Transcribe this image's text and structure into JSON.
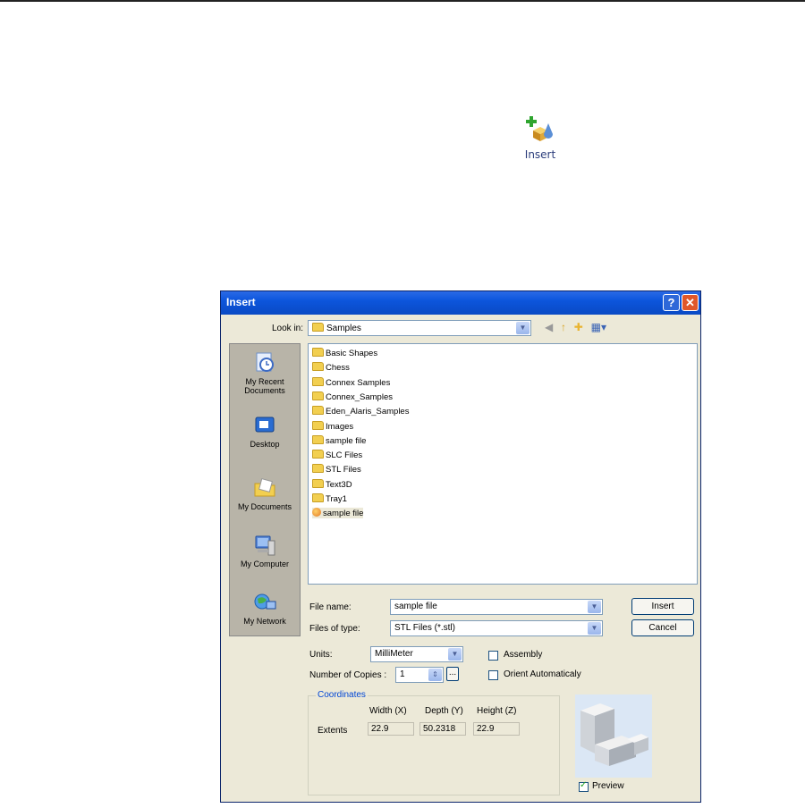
{
  "toolbar": {
    "insert_label": "Insert"
  },
  "dialog": {
    "title": "Insert",
    "help_glyph": "?",
    "close_glyph": "✕",
    "look_in_label": "Look in:",
    "look_in_value": "Samples",
    "places": [
      "My Recent Documents",
      "Desktop",
      "My Documents",
      "My Computer",
      "My Network"
    ],
    "files": [
      {
        "name": "Basic Shapes",
        "type": "folder"
      },
      {
        "name": "Chess",
        "type": "folder"
      },
      {
        "name": "Connex Samples",
        "type": "folder"
      },
      {
        "name": "Connex_Samples",
        "type": "folder"
      },
      {
        "name": "Eden_Alaris_Samples",
        "type": "folder"
      },
      {
        "name": "Images",
        "type": "folder"
      },
      {
        "name": "sample file",
        "type": "folder"
      },
      {
        "name": "SLC Files",
        "type": "folder"
      },
      {
        "name": "STL Files",
        "type": "folder"
      },
      {
        "name": "Text3D",
        "type": "folder"
      },
      {
        "name": "Tray1",
        "type": "folder"
      },
      {
        "name": "sample file",
        "type": "stl-file"
      }
    ],
    "file_name_label": "File name:",
    "file_name_value": "sample file",
    "files_of_type_label": "Files of type:",
    "files_of_type_value": "STL Files (*.stl)",
    "insert_button": "Insert",
    "cancel_button": "Cancel",
    "units_label": "Units:",
    "units_value": "MilliMeter",
    "copies_label": "Number of Copies :",
    "copies_value": "1",
    "copies_more": "...",
    "assembly_label": "Assembly",
    "assembly_checked": false,
    "orient_label": "Orient Automaticaly",
    "orient_checked": false,
    "coordinates_title": "Coordinates",
    "col_width": "Width (X)",
    "col_depth": "Depth (Y)",
    "col_height": "Height (Z)",
    "extents_label": "Extents",
    "extents": {
      "width": "22.9",
      "depth": "50.2318",
      "height": "22.9"
    },
    "preview_label": "Preview",
    "preview_checked": true
  }
}
